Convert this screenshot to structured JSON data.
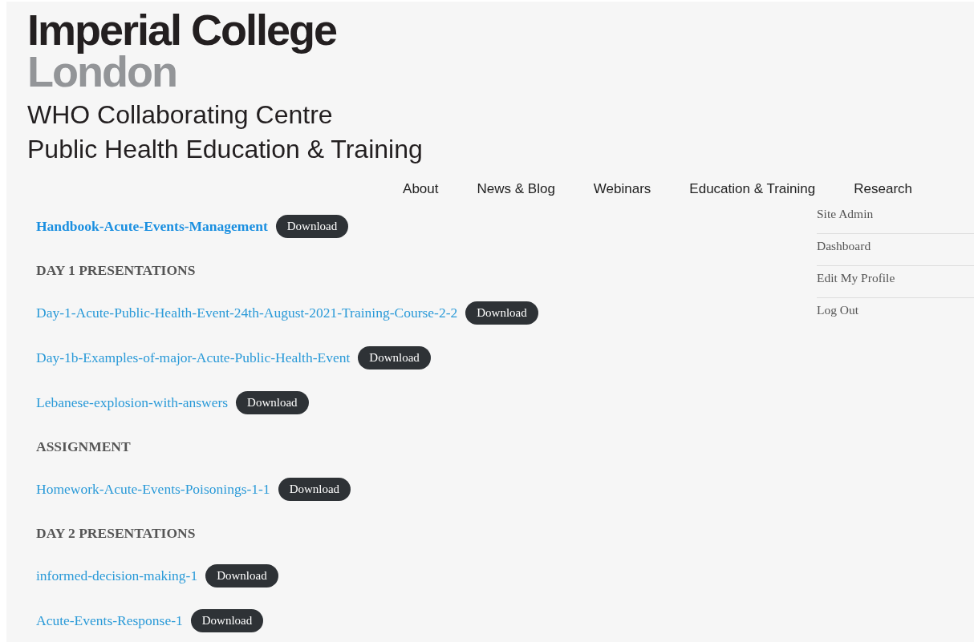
{
  "logo": {
    "line_1": "Imperial College",
    "line_2": "London"
  },
  "subtitle": [
    "WHO Collaborating Centre",
    "Public Health Education & Training"
  ],
  "nav": [
    "About",
    "News & Blog",
    "Webinars",
    "Education & Training",
    "Research"
  ],
  "content": [
    {
      "kind": "featured-file",
      "name": "Handbook-Acute-Events-Management",
      "button": "Download"
    },
    {
      "kind": "heading",
      "text": "DAY 1 PRESENTATIONS"
    },
    {
      "kind": "file",
      "name": "Day-1-Acute-Public-Health-Event-24th-August-2021-Training-Course-2-2",
      "button": "Download"
    },
    {
      "kind": "file",
      "name": "Day-1b-Examples-of-major-Acute-Public-Health-Event",
      "button": "Download"
    },
    {
      "kind": "file",
      "name": "Lebanese-explosion-with-answers",
      "button": "Download"
    },
    {
      "kind": "heading",
      "text": "ASSIGNMENT"
    },
    {
      "kind": "file",
      "name": "Homework-Acute-Events-Poisonings-1-1",
      "button": "Download"
    },
    {
      "kind": "heading",
      "text": "DAY 2 PRESENTATIONS"
    },
    {
      "kind": "file",
      "name": "informed-decision-making-1",
      "button": "Download"
    },
    {
      "kind": "file",
      "name": "Acute-Events-Response-1",
      "button": "Download"
    }
  ],
  "sidebar": {
    "items": [
      "Site Admin",
      "Dashboard",
      "Edit My Profile",
      "Log Out"
    ]
  }
}
